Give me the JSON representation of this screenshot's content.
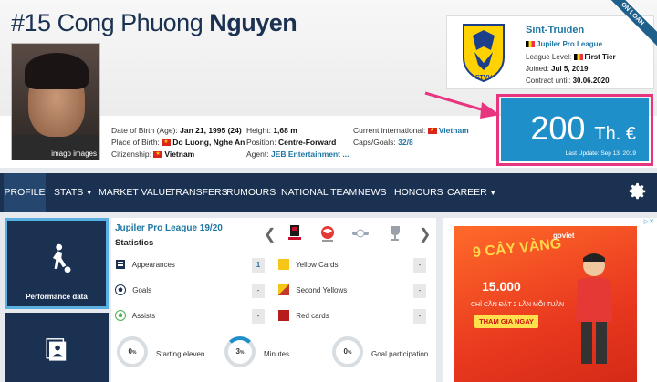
{
  "player": {
    "number": "#15",
    "first_name": "Cong Phuong",
    "last_name": "Nguyen",
    "photo_credit": "imago images",
    "dob_label": "Date of Birth (Age):",
    "dob_value": "Jan 21, 1995 (24)",
    "pob_label": "Place of Birth:",
    "pob_value": "Do Luong, Nghe An",
    "citizenship_label": "Citizenship:",
    "citizenship_value": "Vietnam",
    "height_label": "Height:",
    "height_value": "1,68 m",
    "position_label": "Position:",
    "position_value": "Centre-Forward",
    "agent_label": "Agent:",
    "agent_value": "JEB Entertainment ...",
    "intl_label": "Current international:",
    "intl_value": "Vietnam",
    "caps_label": "Caps/Goals:",
    "caps_value": "32/8"
  },
  "club": {
    "name": "Sint-Truiden",
    "league": "Jupiler Pro League",
    "level_label": "League Level:",
    "level_value": "First Tier",
    "joined_label": "Joined:",
    "joined_value": "Jul 5, 2019",
    "contract_label": "Contract until:",
    "contract_value": "30.06.2020",
    "crest_text": "STVV",
    "loan_badge": "ON LOAN"
  },
  "market_value": {
    "amount": "200",
    "unit": "Th. €",
    "last_update": "Last Update: Sep 13, 2019"
  },
  "nav": {
    "items": [
      "PROFILE",
      "STATS",
      "MARKET VALUE",
      "TRANSFERS",
      "RUMOURS",
      "NATIONAL TEAM",
      "NEWS",
      "HONOURS",
      "CAREER"
    ]
  },
  "tiles": {
    "performance_label": "Performance data"
  },
  "stats": {
    "league_title": "Jupiler Pro League 19/20",
    "section_title": "Statistics",
    "rows_left": [
      {
        "label": "Appearances",
        "value": "1"
      },
      {
        "label": "Goals",
        "value": "-"
      },
      {
        "label": "Assists",
        "value": "-"
      }
    ],
    "rows_right": [
      {
        "label": "Yellow Cards",
        "value": "-"
      },
      {
        "label": "Second Yellows",
        "value": "-"
      },
      {
        "label": "Red cards",
        "value": "-"
      }
    ],
    "circles": [
      {
        "value": "0",
        "suffix": "%",
        "label": "Starting eleven",
        "fraction": 0
      },
      {
        "value": "3",
        "suffix": "%",
        "label": "Minutes",
        "fraction": 0.03
      },
      {
        "value": "0",
        "suffix": "%",
        "label": "Goal participation",
        "fraction": 0
      }
    ]
  },
  "ad": {
    "headline": "9 CÂY VÀNG",
    "brand": "goviet",
    "amount": "15.000",
    "line": "CHỈ CẦN ĐẶT 2 LẦN MỖI TUẦN",
    "cta": "THAM GIA NGAY"
  },
  "colors": {
    "navy": "#1a3151",
    "accent_blue": "#1f8fc9",
    "link_blue": "#1d75a3",
    "highlight_pink": "#e8357f"
  }
}
